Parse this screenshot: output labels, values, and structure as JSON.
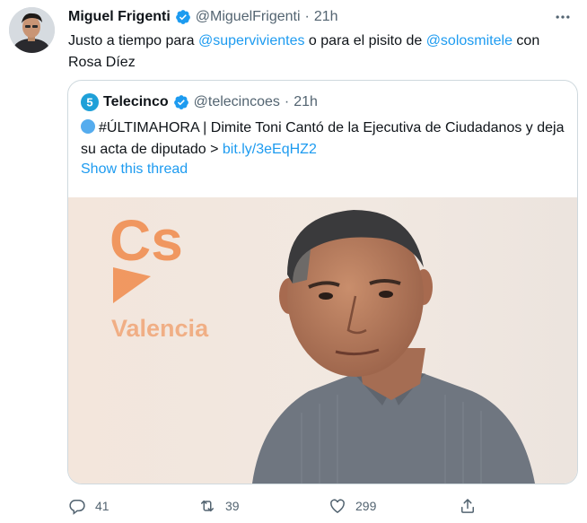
{
  "author": {
    "name": "Miguel Frigenti",
    "handle": "@MiguelFrigenti",
    "separator": "·",
    "time": "21h"
  },
  "tweet": {
    "part1": "Justo a tiempo para ",
    "mention1": "@supervivientes",
    "part2": " o para el pisito de ",
    "mention2": "@solosmitele",
    "part3": " con Rosa Díez"
  },
  "quote": {
    "name": "Telecinco",
    "handle": "@telecincoes",
    "separator": "·",
    "time": "21h",
    "logo_text": "5",
    "text": "#ÚLTIMAHORA | Dimite Toni Cantó de la Ejecutiva de Ciudadanos y deja su acta de diputado > ",
    "link": "bit.ly/3eEqHZ2",
    "show_thread": "Show this thread",
    "media": {
      "sign_logo": "Cs",
      "sign_text": "Valencia"
    }
  },
  "actions": {
    "replies": "41",
    "retweets": "39",
    "likes": "299"
  },
  "colors": {
    "accent": "#1d9bf0",
    "text": "#0f1419",
    "muted": "#536471",
    "border": "#cfd9de",
    "cs_orange": "#f08a4b"
  },
  "icons": [
    "verified-badge-icon",
    "more-icon",
    "reply-icon",
    "retweet-icon",
    "like-icon",
    "share-icon"
  ]
}
